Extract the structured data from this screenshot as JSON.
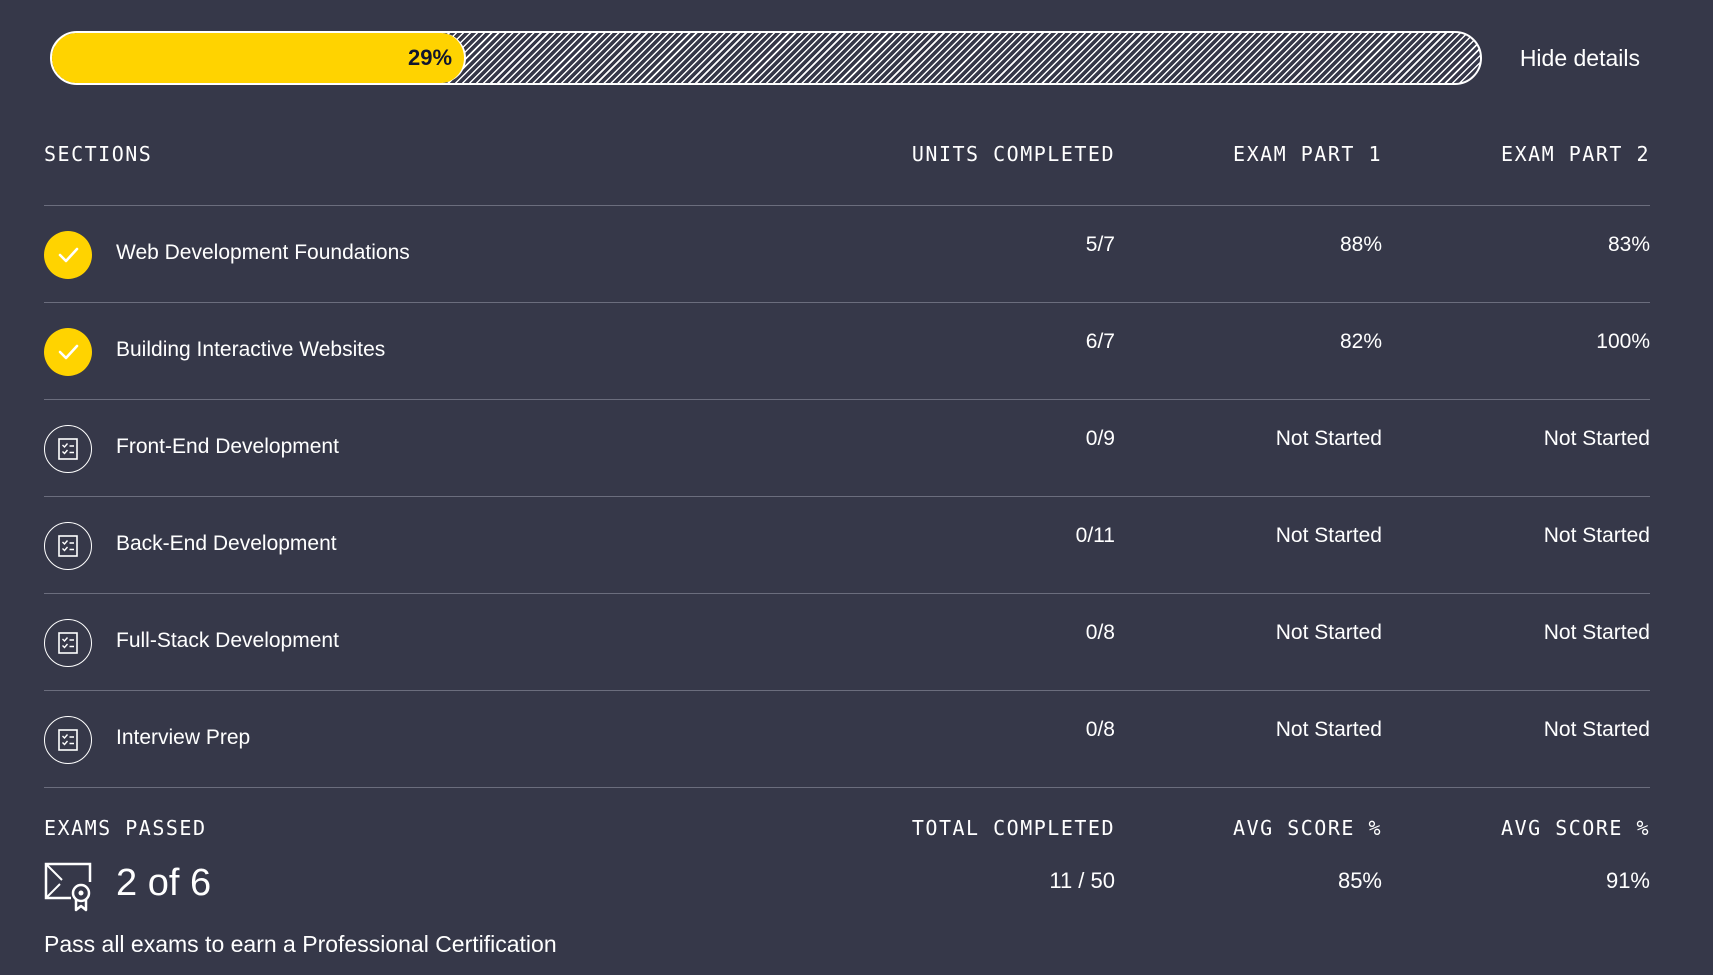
{
  "progress": {
    "percent_label": "29%",
    "fraction": 0.29,
    "toggle_label": "Hide details"
  },
  "columns": {
    "sections": "SECTIONS",
    "units_completed": "UNITS COMPLETED",
    "exam_part_1": "EXAM PART 1",
    "exam_part_2": "EXAM PART 2"
  },
  "sections": [
    {
      "name": "Web Development Foundations",
      "completed": true,
      "units": "5/7",
      "exam1": "88%",
      "exam2": "83%"
    },
    {
      "name": "Building Interactive Websites",
      "completed": true,
      "units": "6/7",
      "exam1": "82%",
      "exam2": "100%"
    },
    {
      "name": "Front-End Development",
      "completed": false,
      "units": "0/9",
      "exam1": "Not Started",
      "exam2": "Not Started"
    },
    {
      "name": "Back-End Development",
      "completed": false,
      "units": "0/11",
      "exam1": "Not Started",
      "exam2": "Not Started"
    },
    {
      "name": "Full-Stack Development",
      "completed": false,
      "units": "0/8",
      "exam1": "Not Started",
      "exam2": "Not Started"
    },
    {
      "name": "Interview Prep",
      "completed": false,
      "units": "0/8",
      "exam1": "Not Started",
      "exam2": "Not Started"
    }
  ],
  "summary": {
    "exams_passed_label": "EXAMS PASSED",
    "exams_passed_value": "2 of 6",
    "total_completed_label": "TOTAL COMPLETED",
    "total_completed_value": "11 / 50",
    "avg1_label": "AVG SCORE %",
    "avg1_value": "85%",
    "avg2_label": "AVG SCORE %",
    "avg2_value": "91%",
    "note": "Pass all exams to earn a Professional Certification"
  },
  "colors": {
    "background": "#363849",
    "accent": "#ffd300",
    "text": "#ffffff"
  },
  "icons": {
    "completed": "check-icon",
    "pending": "checklist-icon",
    "certificate": "certificate-icon"
  }
}
